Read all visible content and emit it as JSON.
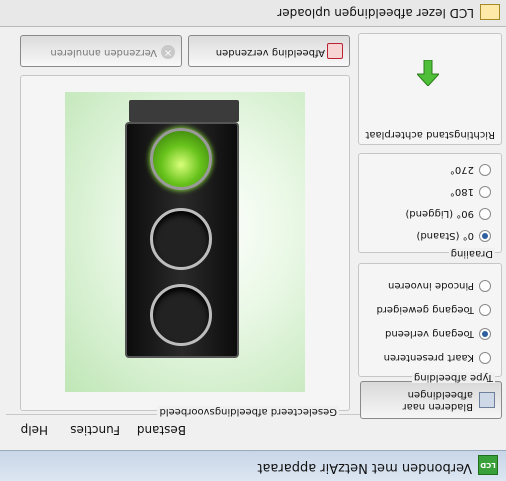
{
  "app": {
    "title": "Verbonden met NetzAir apparaat",
    "title_icon": "LCD"
  },
  "menu": {
    "file": "Bestand",
    "functions": "Functies",
    "help": "Help"
  },
  "image_type": {
    "label": "Type afbeelding",
    "options": [
      "Kaart presenteren",
      "Toegang verleend",
      "Toegang geweigerd",
      "Pincode invoeren"
    ],
    "selected": "Toegang verleend"
  },
  "direction": {
    "label": "Draaiing",
    "options": [
      "0° (Staand)",
      "90° (Liggend)",
      "180°",
      "270°"
    ],
    "selected": "0° (Staand)"
  },
  "browse": {
    "label": "Bladeren naar afbeeldingen"
  },
  "side": {
    "label": "Richtingstand achterplaat"
  },
  "preview": {
    "label": "Geselecteerd afbeeldingsvoorbeeld"
  },
  "buttons": {
    "send": "Afbeelding verzenden",
    "cancel": "Verzenden annuleren"
  },
  "status": {
    "text": "LCD lezer afbeeldingen uploader"
  },
  "colors": {
    "accent_green": "#3aa13a",
    "lamp_green": "#67c21b"
  }
}
